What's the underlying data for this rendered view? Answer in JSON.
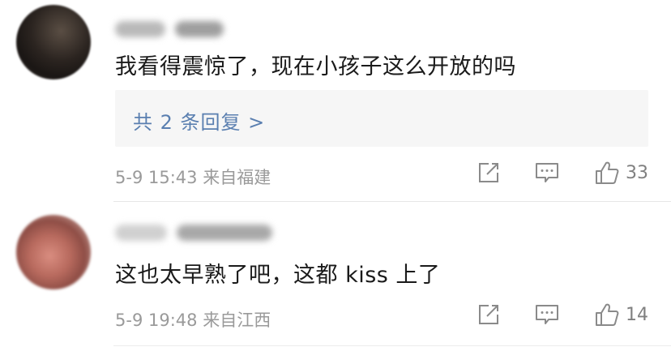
{
  "comments": [
    {
      "content": "我看得震惊了，现在小孩子这么开放的吗",
      "reply_link": "共 2 条回复 >",
      "date": "5-9",
      "time": "15:43",
      "location": "来自福建",
      "likes": "33"
    },
    {
      "content": "这也太早熟了吧，这都 kiss 上了",
      "date": "5-9",
      "time": "19:48",
      "location": "来自江西",
      "likes": "14"
    }
  ],
  "icons": {
    "forward": "forward-icon",
    "comment": "comment-icon",
    "like": "thumbs-up-icon"
  },
  "colors": {
    "link": "#5a7fb0",
    "meta": "#9a9a9a",
    "text": "#1a1a1a",
    "reply_bg": "#f6f6f6"
  }
}
